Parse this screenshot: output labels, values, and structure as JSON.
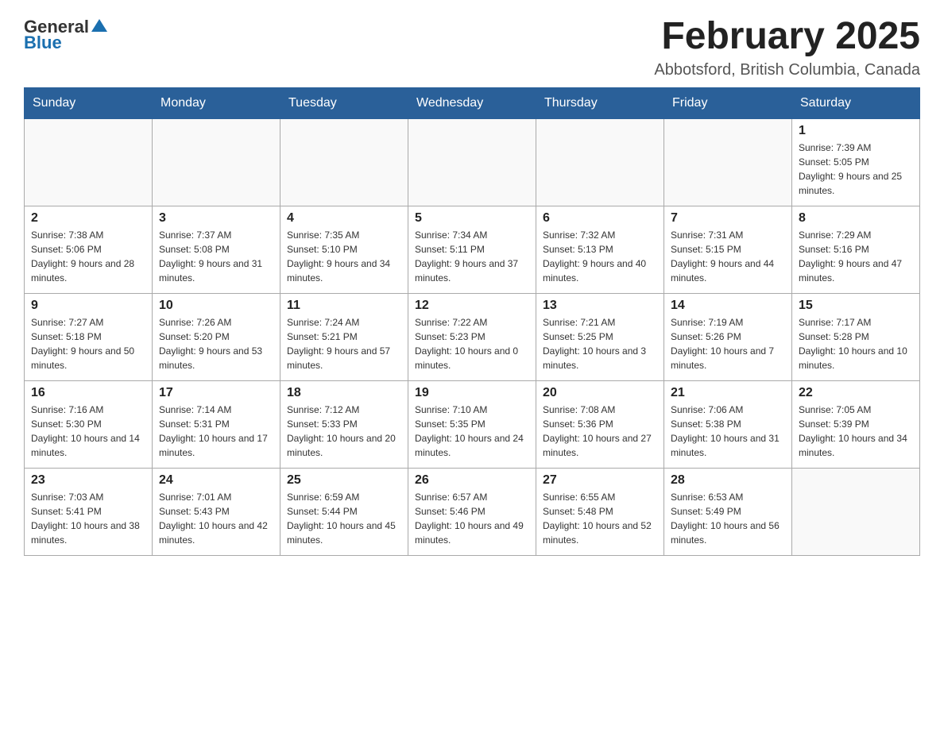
{
  "logo": {
    "general": "General",
    "blue": "Blue"
  },
  "header": {
    "month": "February 2025",
    "location": "Abbotsford, British Columbia, Canada"
  },
  "days_of_week": [
    "Sunday",
    "Monday",
    "Tuesday",
    "Wednesday",
    "Thursday",
    "Friday",
    "Saturday"
  ],
  "weeks": [
    [
      {
        "day": "",
        "info": ""
      },
      {
        "day": "",
        "info": ""
      },
      {
        "day": "",
        "info": ""
      },
      {
        "day": "",
        "info": ""
      },
      {
        "day": "",
        "info": ""
      },
      {
        "day": "",
        "info": ""
      },
      {
        "day": "1",
        "info": "Sunrise: 7:39 AM\nSunset: 5:05 PM\nDaylight: 9 hours and 25 minutes."
      }
    ],
    [
      {
        "day": "2",
        "info": "Sunrise: 7:38 AM\nSunset: 5:06 PM\nDaylight: 9 hours and 28 minutes."
      },
      {
        "day": "3",
        "info": "Sunrise: 7:37 AM\nSunset: 5:08 PM\nDaylight: 9 hours and 31 minutes."
      },
      {
        "day": "4",
        "info": "Sunrise: 7:35 AM\nSunset: 5:10 PM\nDaylight: 9 hours and 34 minutes."
      },
      {
        "day": "5",
        "info": "Sunrise: 7:34 AM\nSunset: 5:11 PM\nDaylight: 9 hours and 37 minutes."
      },
      {
        "day": "6",
        "info": "Sunrise: 7:32 AM\nSunset: 5:13 PM\nDaylight: 9 hours and 40 minutes."
      },
      {
        "day": "7",
        "info": "Sunrise: 7:31 AM\nSunset: 5:15 PM\nDaylight: 9 hours and 44 minutes."
      },
      {
        "day": "8",
        "info": "Sunrise: 7:29 AM\nSunset: 5:16 PM\nDaylight: 9 hours and 47 minutes."
      }
    ],
    [
      {
        "day": "9",
        "info": "Sunrise: 7:27 AM\nSunset: 5:18 PM\nDaylight: 9 hours and 50 minutes."
      },
      {
        "day": "10",
        "info": "Sunrise: 7:26 AM\nSunset: 5:20 PM\nDaylight: 9 hours and 53 minutes."
      },
      {
        "day": "11",
        "info": "Sunrise: 7:24 AM\nSunset: 5:21 PM\nDaylight: 9 hours and 57 minutes."
      },
      {
        "day": "12",
        "info": "Sunrise: 7:22 AM\nSunset: 5:23 PM\nDaylight: 10 hours and 0 minutes."
      },
      {
        "day": "13",
        "info": "Sunrise: 7:21 AM\nSunset: 5:25 PM\nDaylight: 10 hours and 3 minutes."
      },
      {
        "day": "14",
        "info": "Sunrise: 7:19 AM\nSunset: 5:26 PM\nDaylight: 10 hours and 7 minutes."
      },
      {
        "day": "15",
        "info": "Sunrise: 7:17 AM\nSunset: 5:28 PM\nDaylight: 10 hours and 10 minutes."
      }
    ],
    [
      {
        "day": "16",
        "info": "Sunrise: 7:16 AM\nSunset: 5:30 PM\nDaylight: 10 hours and 14 minutes."
      },
      {
        "day": "17",
        "info": "Sunrise: 7:14 AM\nSunset: 5:31 PM\nDaylight: 10 hours and 17 minutes."
      },
      {
        "day": "18",
        "info": "Sunrise: 7:12 AM\nSunset: 5:33 PM\nDaylight: 10 hours and 20 minutes."
      },
      {
        "day": "19",
        "info": "Sunrise: 7:10 AM\nSunset: 5:35 PM\nDaylight: 10 hours and 24 minutes."
      },
      {
        "day": "20",
        "info": "Sunrise: 7:08 AM\nSunset: 5:36 PM\nDaylight: 10 hours and 27 minutes."
      },
      {
        "day": "21",
        "info": "Sunrise: 7:06 AM\nSunset: 5:38 PM\nDaylight: 10 hours and 31 minutes."
      },
      {
        "day": "22",
        "info": "Sunrise: 7:05 AM\nSunset: 5:39 PM\nDaylight: 10 hours and 34 minutes."
      }
    ],
    [
      {
        "day": "23",
        "info": "Sunrise: 7:03 AM\nSunset: 5:41 PM\nDaylight: 10 hours and 38 minutes."
      },
      {
        "day": "24",
        "info": "Sunrise: 7:01 AM\nSunset: 5:43 PM\nDaylight: 10 hours and 42 minutes."
      },
      {
        "day": "25",
        "info": "Sunrise: 6:59 AM\nSunset: 5:44 PM\nDaylight: 10 hours and 45 minutes."
      },
      {
        "day": "26",
        "info": "Sunrise: 6:57 AM\nSunset: 5:46 PM\nDaylight: 10 hours and 49 minutes."
      },
      {
        "day": "27",
        "info": "Sunrise: 6:55 AM\nSunset: 5:48 PM\nDaylight: 10 hours and 52 minutes."
      },
      {
        "day": "28",
        "info": "Sunrise: 6:53 AM\nSunset: 5:49 PM\nDaylight: 10 hours and 56 minutes."
      },
      {
        "day": "",
        "info": ""
      }
    ]
  ]
}
